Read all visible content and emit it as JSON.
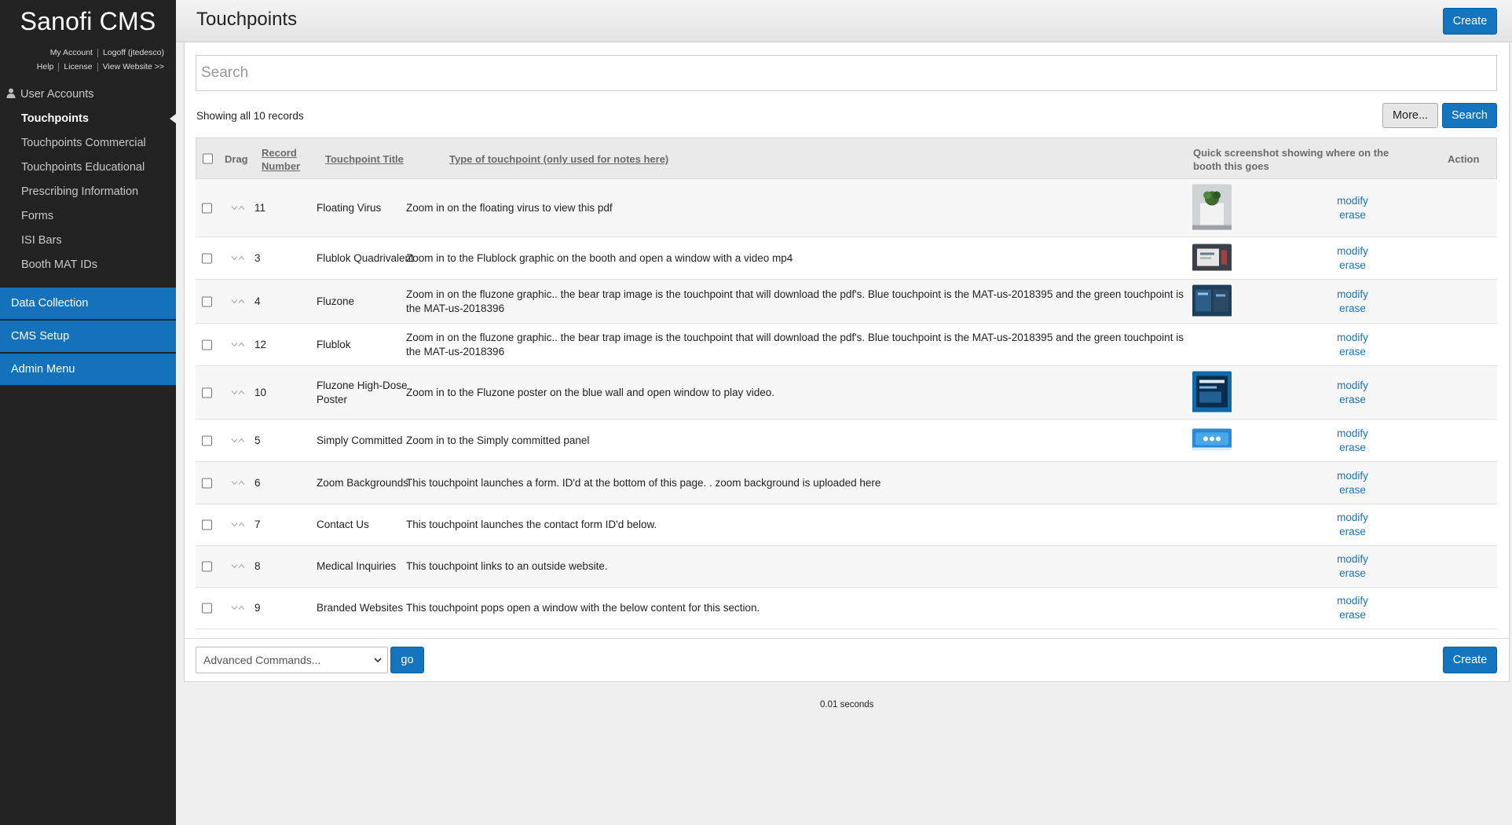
{
  "sidebar": {
    "brand": "Sanofi CMS",
    "links": {
      "my_account": "My Account",
      "logoff": "Logoff (jtedesco)",
      "help": "Help",
      "license": "License",
      "view_website": "View Website >>"
    },
    "nav_items": [
      {
        "label": "User Accounts"
      },
      {
        "label": "Touchpoints"
      },
      {
        "label": "Touchpoints Commercial"
      },
      {
        "label": "Touchpoints Educational"
      },
      {
        "label": "Prescribing Information"
      },
      {
        "label": "Forms"
      },
      {
        "label": "ISI Bars"
      },
      {
        "label": "Booth MAT IDs"
      }
    ],
    "menus": [
      {
        "label": "Data Collection"
      },
      {
        "label": "CMS Setup"
      },
      {
        "label": "Admin Menu"
      }
    ]
  },
  "header": {
    "title": "Touchpoints",
    "create_label": "Create"
  },
  "search": {
    "placeholder": "Search",
    "showing": "Showing all 10 records",
    "more_label": "More...",
    "search_label": "Search"
  },
  "table": {
    "headers": {
      "drag": "Drag",
      "record_number": "Record Number",
      "title": "Touchpoint Title",
      "type": "Type of touchpoint (only used for notes here)",
      "screenshot": "Quick screenshot showing where on the booth this goes",
      "action": "Action"
    },
    "modify_label": "modify",
    "erase_label": "erase",
    "rows": [
      {
        "record": "11",
        "title": "Floating Virus",
        "type": "Zoom in on the floating virus to view this pdf",
        "thumb": "plant"
      },
      {
        "record": "3",
        "title": "Flublok Quadrivalent",
        "type": "Zoom in to the Flublock graphic on the booth and open a window with a video mp4",
        "thumb": "booth"
      },
      {
        "record": "4",
        "title": "Fluzone",
        "type": "Zoom in on the fluzone graphic.. the bear trap image is the touchpoint that will download the pdf's. Blue touchpoint is the MAT-us-2018395 and the green touchpoint is the MAT-us-2018396",
        "thumb": "dark"
      },
      {
        "record": "12",
        "title": "Flublok",
        "type": "Zoom in on the fluzone graphic.. the bear trap image is the touchpoint that will download the pdf's. Blue touchpoint is the MAT-us-2018395 and the green touchpoint is the MAT-us-2018396",
        "thumb": ""
      },
      {
        "record": "10",
        "title": "Fluzone High-Dose Poster",
        "type": "Zoom in to the Fluzone poster on the blue wall and open window to play video.",
        "thumb": "poster"
      },
      {
        "record": "5",
        "title": "Simply Committed",
        "type": "Zoom in to the Simply committed panel",
        "thumb": "panel"
      },
      {
        "record": "6",
        "title": "Zoom Backgrounds",
        "type": "This touchpoint launches a form. ID'd at the bottom of this page. . zoom background is uploaded here",
        "thumb": ""
      },
      {
        "record": "7",
        "title": "Contact Us",
        "type": "This touchpoint launches the contact form ID'd below.",
        "thumb": ""
      },
      {
        "record": "8",
        "title": "Medical Inquiries",
        "type": "This touchpoint links to an outside website.",
        "thumb": ""
      },
      {
        "record": "9",
        "title": "Branded Websites",
        "type": "This touchpoint pops open a window with the below content for this section.",
        "thumb": ""
      }
    ]
  },
  "footer": {
    "advanced_commands": "Advanced Commands...",
    "go_label": "go",
    "create_label": "Create",
    "timing": "0.01 seconds"
  },
  "colors": {
    "sidebar_bg": "#222222",
    "accent_blue": "#1474bd",
    "link_blue": "#1a73b8"
  }
}
